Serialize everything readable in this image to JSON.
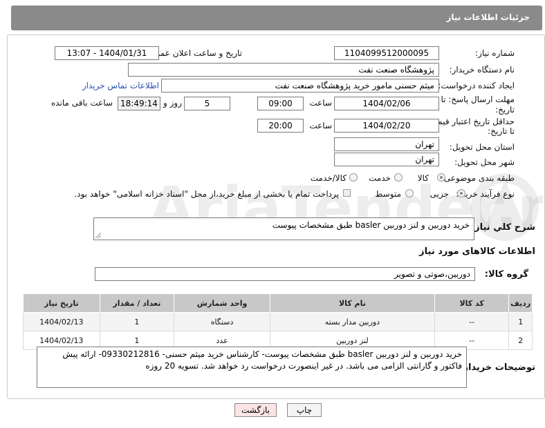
{
  "header": {
    "title": "جزئیات اطلاعات نیاز"
  },
  "labels": {
    "need_number": "شماره نیاز:",
    "announce_datetime": "تاریخ و ساعت اعلان عمومی:",
    "buyer_org": "نام دستگاه خریدار:",
    "requester": "ایجاد کننده درخواست:",
    "contact_link": "اطلاعات تماس خریدار",
    "reply_deadline_1": "مهلت ارسال پاسخ: تا",
    "reply_deadline_2": "تاریخ:",
    "time": "ساعت",
    "day_and": "روز و",
    "remaining": "ساعت باقی مانده",
    "price_validity_1": "حداقل تاریخ اعتبار قیمت:",
    "price_validity_2": "تا تاریخ:",
    "province": "استان محل تحویل:",
    "city": "شهر محل تحویل:",
    "category": "طبقه بندی موضوعی:",
    "process": "نوع فرآیند خرید :",
    "description": "شرح کلي نياز:",
    "goods_info": "اطلاعات کالاهای مورد نیاز",
    "goods_group": "گروه کالا:",
    "buyer_notes": "توضیحات خریدار:"
  },
  "values": {
    "need_number": "1104099512000095",
    "announce_datetime": "1404/01/31 - 13:07",
    "buyer_org": "پژوهشگاه صنعت نفت",
    "requester": "میثم حسنی مامور خرید پژوهشگاه صنعت نفت",
    "reply_date": "1404/02/06",
    "reply_time": "09:00",
    "days": "5",
    "remaining_time": "18:49:14",
    "validity_date": "1404/02/20",
    "validity_time": "20:00",
    "province": "تهران",
    "city": "تهران",
    "description": "خرید دوربین و لنز دوربین basler طبق مشخصات پیوست",
    "goods_group": "دوربین،صوتی و تصویر",
    "buyer_notes": "خرید دوربین و لنز دوربین basler طبق مشخصات پیوست- کارشناس خرید میثم حسنی- 09330212816- ارائه پیش فاکتور و گارانتی الزامی می باشد. در غیر اینصورت درخواست رد خواهد شد. تسویه 20 روزه"
  },
  "category_options": [
    {
      "label": "کالا",
      "selected": true
    },
    {
      "label": "خدمت",
      "selected": false
    },
    {
      "label": "کالا/خدمت",
      "selected": false
    }
  ],
  "process_options": [
    {
      "label": "جزیی",
      "selected": true
    },
    {
      "label": "متوسط",
      "selected": false
    }
  ],
  "payment_note": "پرداخت تمام یا بخشی از مبلغ خرید،از محل \"اسناد خزانه اسلامی\" خواهد بود.",
  "table": {
    "headers": [
      "ردیف",
      "کد کالا",
      "نام کالا",
      "واحد شمارش",
      "تعداد / مقدار",
      "تاریخ نیاز"
    ],
    "rows": [
      [
        "1",
        "--",
        "دوربین مدار بسته",
        "دستگاه",
        "1",
        "1404/02/13"
      ],
      [
        "2",
        "--",
        "لنز دوربین",
        "عدد",
        "1",
        "1404/02/13"
      ]
    ]
  },
  "buttons": {
    "print": "چاپ",
    "back": "بازگشت"
  },
  "watermark": {
    "text": "AriaTender.neT"
  }
}
